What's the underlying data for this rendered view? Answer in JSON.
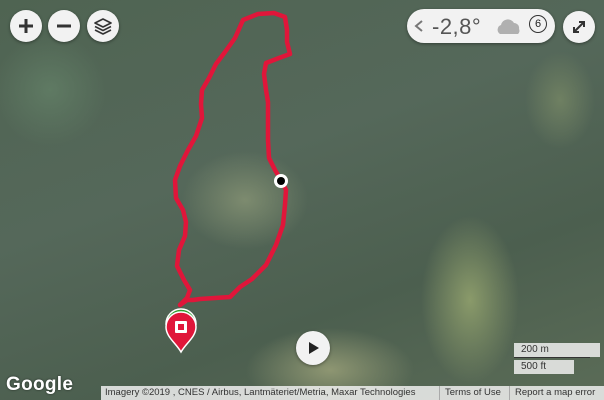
{
  "controls": {
    "zoom_in_icon": "plus-icon",
    "zoom_out_icon": "minus-icon",
    "layers_icon": "layers-icon",
    "fullscreen_icon": "expand-icon",
    "play_icon": "play-icon"
  },
  "weather": {
    "temperature": "-2,8°",
    "wind_speed": "6",
    "condition_icon": "cloud-icon",
    "collapse_icon": "chevron-left-icon"
  },
  "footer": {
    "logo": "Google",
    "imagery": "Imagery ©2019 , CNES / Airbus, Lantmäteriet/Metria, Maxar Technologies",
    "terms": "Terms of Use",
    "report": "Report a map error"
  },
  "scale": {
    "metric": "200 m",
    "imperial": "500 ft"
  },
  "colors": {
    "track": "#e0163a",
    "start_marker": "#2e9e2e",
    "end_marker": "#e0163a"
  }
}
